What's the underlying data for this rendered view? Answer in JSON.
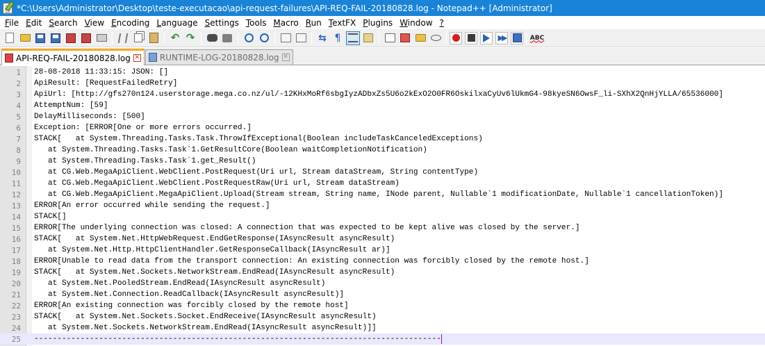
{
  "window": {
    "title": "*C:\\Users\\Administrator\\Desktop\\teste-executacao\\api-request-failures\\API-REQ-FAIL-20180828.log - Notepad++ [Administrator]"
  },
  "menu": {
    "items": [
      {
        "first": "F",
        "rest": "ile"
      },
      {
        "first": "E",
        "rest": "dit"
      },
      {
        "first": "S",
        "rest": "earch"
      },
      {
        "first": "V",
        "rest": "iew"
      },
      {
        "first": "E",
        "rest": "ncoding"
      },
      {
        "first": "L",
        "rest": "anguage"
      },
      {
        "first": "S",
        "rest": "ettings"
      },
      {
        "first": "T",
        "rest": "ools"
      },
      {
        "first": "M",
        "rest": "acro"
      },
      {
        "first": "R",
        "rest": "un"
      },
      {
        "first": "T",
        "rest": "extFX"
      },
      {
        "first": "P",
        "rest": "lugins"
      },
      {
        "first": "W",
        "rest": "indow"
      },
      {
        "first": "?",
        "rest": ""
      }
    ]
  },
  "toolbar": {
    "spell_label": "ABC"
  },
  "tabs": [
    {
      "label": "API-REQ-FAIL-20180828.log",
      "active": true
    },
    {
      "label": "RUNTIME-LOG-20180828.log",
      "active": false
    }
  ],
  "editor": {
    "current_line": 25,
    "lines": [
      "28-08-2018 11:33:15: JSON: []",
      "ApiResult: [RequestFailedRetry]",
      "ApiUrl: [http://gfs270n124.userstorage.mega.co.nz/ul/-12KHxMoRf6sbgIyzADbxZs5U6o2kExO2O0FR6OskilxaCyUv6lUkmG4-98kyeSN6OwsF_li-SXhX2QnHjYLLA/65536000]",
      "AttemptNum: [59]",
      "DelayMilliseconds: [500]",
      "Exception: [ERROR[One or more errors occurred.]",
      "STACK[   at System.Threading.Tasks.Task.ThrowIfExceptional(Boolean includeTaskCanceledExceptions)",
      "   at System.Threading.Tasks.Task`1.GetResultCore(Boolean waitCompletionNotification)",
      "   at System.Threading.Tasks.Task`1.get_Result()",
      "   at CG.Web.MegaApiClient.WebClient.PostRequest(Uri url, Stream dataStream, String contentType)",
      "   at CG.Web.MegaApiClient.WebClient.PostRequestRaw(Uri url, Stream dataStream)",
      "   at CG.Web.MegaApiClient.MegaApiClient.Upload(Stream stream, String name, INode parent, Nullable`1 modificationDate, Nullable`1 cancellationToken)]",
      "ERROR[An error occurred while sending the request.]",
      "STACK[]",
      "ERROR[The underlying connection was closed: A connection that was expected to be kept alive was closed by the server.]",
      "STACK[   at System.Net.HttpWebRequest.EndGetResponse(IAsyncResult asyncResult)",
      "   at System.Net.Http.HttpClientHandler.GetResponseCallback(IAsyncResult ar)]",
      "ERROR[Unable to read data from the transport connection: An existing connection was forcibly closed by the remote host.]",
      "STACK[   at System.Net.Sockets.NetworkStream.EndRead(IAsyncResult asyncResult)",
      "   at System.Net.PooledStream.EndRead(IAsyncResult asyncResult)",
      "   at System.Net.Connection.ReadCallback(IAsyncResult asyncResult)]",
      "ERROR[An existing connection was forcibly closed by the remote host]",
      "STACK[   at System.Net.Sockets.Socket.EndReceive(IAsyncResult asyncResult)",
      "   at System.Net.Sockets.NetworkStream.EndRead(IAsyncResult asyncResult)]]",
      "----------------------------------------------------------------------------------------"
    ]
  }
}
